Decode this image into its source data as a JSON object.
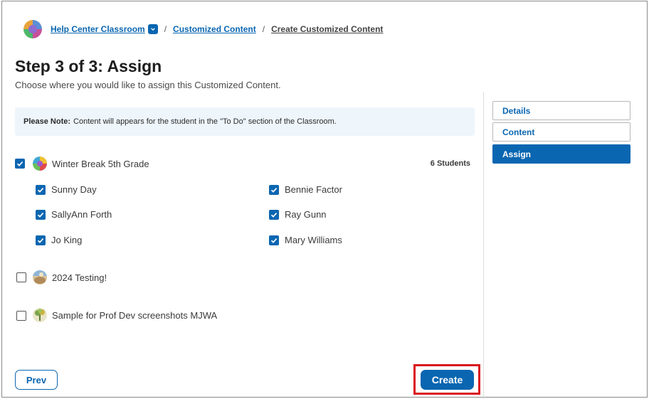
{
  "breadcrumb": {
    "classroom": "Help Center Classroom",
    "section": "Customized Content",
    "current": "Create Customized Content",
    "separator": "/"
  },
  "page": {
    "title": "Step 3 of 3: Assign",
    "subtitle": "Choose where you would like to assign this Customized Content."
  },
  "note": {
    "label": "Please Note:",
    "text": "Content will appears for the student in the \"To Do\" section of the Classroom."
  },
  "classes": [
    {
      "name": "Winter Break 5th Grade",
      "count": "6 Students",
      "checked": true,
      "students": [
        {
          "name": "Sunny Day",
          "checked": true
        },
        {
          "name": "Bennie Factor",
          "checked": true
        },
        {
          "name": "SallyAnn Forth",
          "checked": true
        },
        {
          "name": "Ray Gunn",
          "checked": true
        },
        {
          "name": "Jo King",
          "checked": true
        },
        {
          "name": "Mary Williams",
          "checked": true
        }
      ]
    },
    {
      "name": "2024 Testing!",
      "checked": false
    },
    {
      "name": "Sample for Prof Dev screenshots MJWA",
      "checked": false
    }
  ],
  "steps": [
    {
      "label": "Details",
      "active": false
    },
    {
      "label": "Content",
      "active": false
    },
    {
      "label": "Assign",
      "active": true
    }
  ],
  "footer": {
    "prev_label": "Prev",
    "create_label": "Create"
  },
  "colors": {
    "accent": "#0a66b1",
    "note_bg": "#eef5fb",
    "highlight": "#d9141f"
  }
}
